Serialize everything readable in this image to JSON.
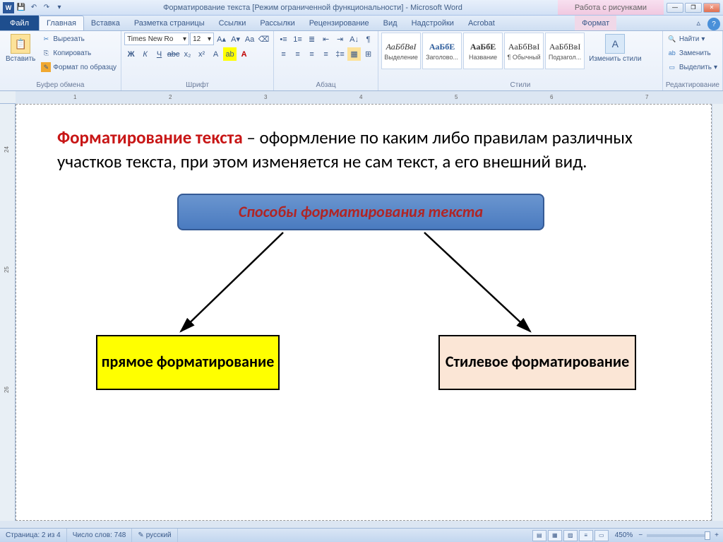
{
  "title": "Форматирование текста [Режим ограниченной функциональности] - Microsoft Word",
  "contextual_tab_group": "Работа с рисунками",
  "file_tab": "Файл",
  "tabs": [
    "Главная",
    "Вставка",
    "Разметка страницы",
    "Ссылки",
    "Рассылки",
    "Рецензирование",
    "Вид",
    "Надстройки",
    "Acrobat"
  ],
  "contextual_tab": "Формат",
  "clipboard": {
    "paste": "Вставить",
    "cut": "Вырезать",
    "copy": "Копировать",
    "format_painter": "Формат по образцу",
    "group_label": "Буфер обмена"
  },
  "font": {
    "name": "Times New Ro",
    "size": "12",
    "group_label": "Шрифт"
  },
  "paragraph": {
    "group_label": "Абзац"
  },
  "styles": {
    "items": [
      {
        "preview": "АаБбВвІ",
        "label": "Выделение"
      },
      {
        "preview": "АаБбЕ",
        "label": "Заголово..."
      },
      {
        "preview": "АаБбЕ",
        "label": "Название"
      },
      {
        "preview": "АаБбВвІ",
        "label": "¶ Обычный"
      },
      {
        "preview": "АаБбВвІ",
        "label": "Подзагол..."
      }
    ],
    "change": "Изменить стили",
    "group_label": "Стили"
  },
  "editing": {
    "find": "Найти",
    "replace": "Заменить",
    "select": "Выделить",
    "group_label": "Редактирование"
  },
  "ruler_marks": [
    "1",
    "2",
    "3",
    "4",
    "5",
    "6",
    "7"
  ],
  "v_ruler_marks": [
    "24",
    "25",
    "26"
  ],
  "document": {
    "term": "Форматирование текста",
    "definition_rest": " – оформление по каким либо правилам различных участков текста, при этом изменяется не сам текст, а его внешний вид.",
    "diagram_title": "Способы форматирования текста",
    "box1": "прямое форматирование",
    "box2": "Стилевое форматирование"
  },
  "status": {
    "page": "Страница: 2 из 4",
    "words": "Число слов: 748",
    "lang": "русский",
    "zoom": "450%"
  }
}
